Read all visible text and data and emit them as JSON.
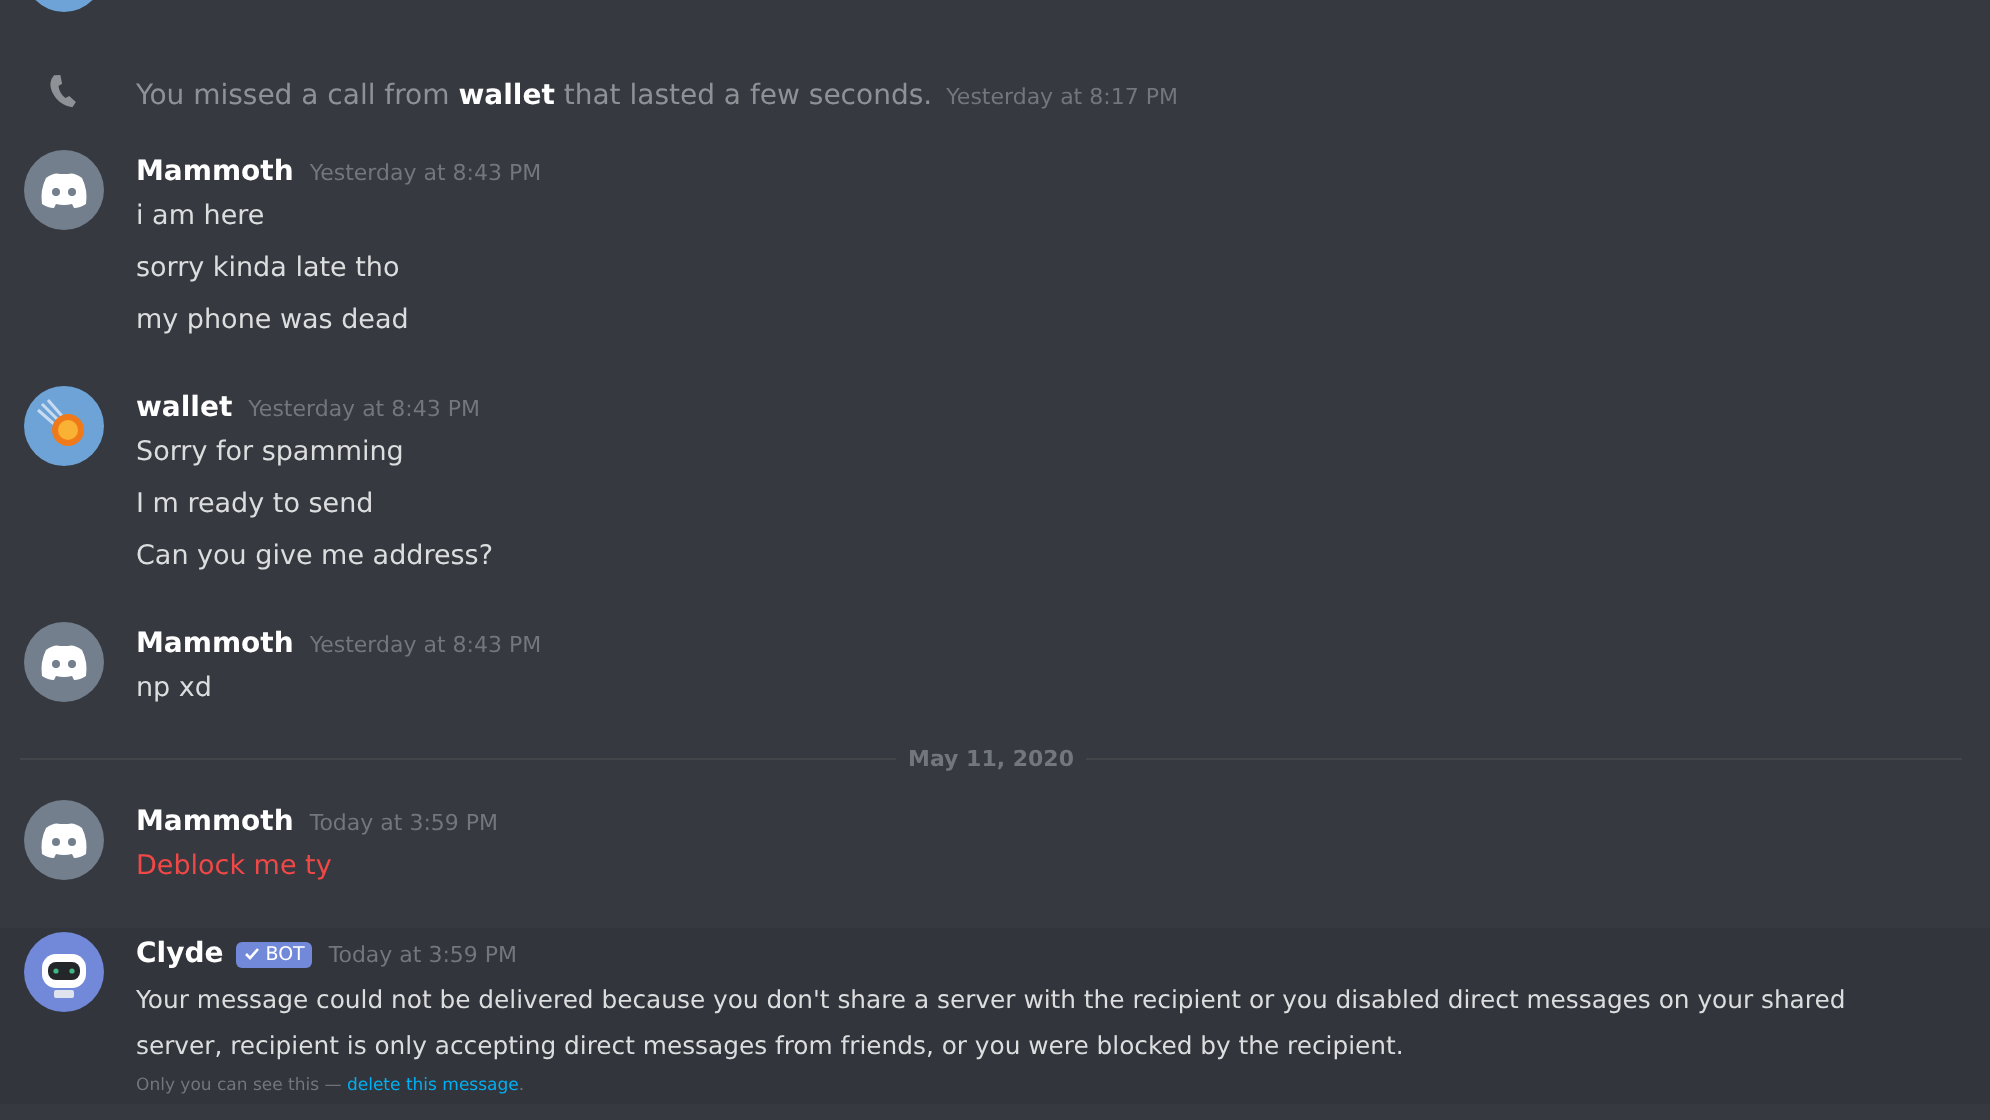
{
  "messages": [
    {
      "kind": "call",
      "text": "You missed a call from **wallet** that lasted a few seconds.",
      "timestamp": "Yesterday at 8:17 PM"
    },
    {
      "kind": "message",
      "author": "Mammoth",
      "avatar": {
        "kind": "discord"
      },
      "timestamp": "Yesterday at 8:43 PM",
      "lines": [
        {
          "text": "i am here",
          "failed": false
        },
        {
          "text": "sorry kinda late tho",
          "failed": false
        },
        {
          "text": "my phone was dead",
          "failed": false
        }
      ]
    },
    {
      "kind": "message",
      "author": "wallet",
      "avatar": {
        "kind": "coin"
      },
      "timestamp": "Yesterday at 8:43 PM",
      "lines": [
        {
          "text": "Sorry for spamming",
          "failed": false
        },
        {
          "text": "I m ready to send",
          "failed": false
        },
        {
          "text": "Can you give me address?",
          "failed": false
        }
      ]
    },
    {
      "kind": "message",
      "author": "Mammoth",
      "avatar": {
        "kind": "discord"
      },
      "timestamp": "Yesterday at 8:43 PM",
      "lines": [
        {
          "text": "np xd",
          "failed": false
        }
      ]
    },
    {
      "kind": "divider",
      "label": "May 11, 2020"
    },
    {
      "kind": "message",
      "author": "Mammoth",
      "avatar": {
        "kind": "discord"
      },
      "timestamp": "Today at 3:59 PM",
      "lines": [
        {
          "text": "Deblock me ty",
          "failed": true
        }
      ]
    },
    {
      "kind": "message",
      "author": "Clyde",
      "avatar": {
        "kind": "robot"
      },
      "bot_tag": "BOT",
      "timestamp": "Today at 3:59 PM",
      "ephemeral": true,
      "lines": [
        {
          "text": "Your message could not be delivered because you don't share a server with the recipient or you disabled direct messages on your shared server, recipient is only accepting direct messages from friends, or you were blocked by the recipient.",
          "failed": false
        }
      ],
      "note": "Only you can see this —",
      "link": "delete this message",
      "note_end": "."
    }
  ]
}
